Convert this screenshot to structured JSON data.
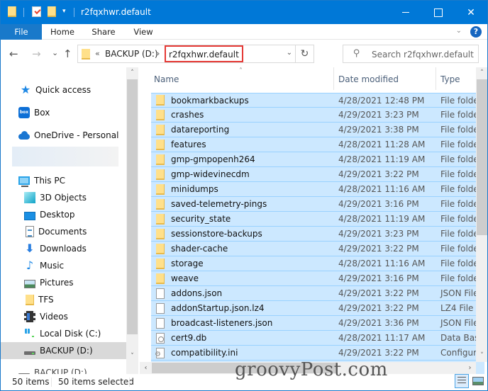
{
  "window": {
    "title": "r2fqxhwr.default",
    "minimize_icon": "minimize-icon",
    "maximize_icon": "maximize-icon",
    "close_icon": "close-icon",
    "close_glyph": "✕"
  },
  "quick_access_toolbar": {
    "items": [
      "folder-icon",
      "properties-icon",
      "new-folder-icon",
      "customize-dropdown-icon"
    ],
    "dropdown_glyph": "▾"
  },
  "ribbon": {
    "tabs": [
      {
        "label": "File"
      },
      {
        "label": "Home"
      },
      {
        "label": "Share"
      },
      {
        "label": "View"
      }
    ],
    "expand_glyph": "⌄",
    "help_glyph": "?"
  },
  "navigation": {
    "back_glyph": "←",
    "forward_glyph": "→",
    "recent_glyph": "⌄",
    "up_glyph": "↑",
    "address": {
      "overflow_glyph": "«",
      "crumbs": [
        "BACKUP (D:)"
      ],
      "separator_glyph": "›",
      "current": "r2fqxhwr.default",
      "dropdown_glyph": "⌄",
      "refresh_glyph": "↻"
    },
    "search": {
      "placeholder": "Search r2fqxhwr.default",
      "icon_glyph": "⚲"
    }
  },
  "nav_pane": {
    "items": [
      {
        "label": "Quick access",
        "icon": "quick-access-star-icon",
        "glyph": "★"
      },
      {
        "label": "Box",
        "icon": "box-icon",
        "glyph": "box"
      },
      {
        "label": "OneDrive - Personal",
        "icon": "onedrive-cloud-icon"
      },
      {
        "label": "This PC",
        "icon": "this-pc-icon"
      },
      {
        "label": "3D Objects",
        "icon": "3d-objects-icon"
      },
      {
        "label": "Desktop",
        "icon": "desktop-icon"
      },
      {
        "label": "Documents",
        "icon": "documents-icon"
      },
      {
        "label": "Downloads",
        "icon": "downloads-icon",
        "glyph": "⬇"
      },
      {
        "label": "Music",
        "icon": "music-icon",
        "glyph": "♪"
      },
      {
        "label": "Pictures",
        "icon": "pictures-icon"
      },
      {
        "label": "TFS",
        "icon": "folder-icon"
      },
      {
        "label": "Videos",
        "icon": "videos-icon"
      },
      {
        "label": "Local Disk (C:)",
        "icon": "local-disk-icon"
      },
      {
        "label": "BACKUP (D:)",
        "icon": "drive-icon",
        "selected": true
      },
      {
        "label": "BACKUP (D:)",
        "icon": "drive-icon"
      }
    ],
    "scroll_up_glyph": "˄",
    "scroll_down_glyph": "˅"
  },
  "file_list": {
    "columns": [
      {
        "label": "Name",
        "sorted": "ascending"
      },
      {
        "label": "Date modified"
      },
      {
        "label": "Type"
      }
    ],
    "sort_glyph": "˄",
    "rows": [
      {
        "name": "bookmarkbackups",
        "date": "4/28/2021 12:48 PM",
        "type": "File folder",
        "kind": "folder"
      },
      {
        "name": "crashes",
        "date": "4/29/2021 3:23 PM",
        "type": "File folder",
        "kind": "folder"
      },
      {
        "name": "datareporting",
        "date": "4/29/2021 3:38 PM",
        "type": "File folder",
        "kind": "folder"
      },
      {
        "name": "features",
        "date": "4/28/2021 11:28 AM",
        "type": "File folder",
        "kind": "folder"
      },
      {
        "name": "gmp-gmpopenh264",
        "date": "4/28/2021 11:19 AM",
        "type": "File folder",
        "kind": "folder"
      },
      {
        "name": "gmp-widevinecdm",
        "date": "4/29/2021 3:22 PM",
        "type": "File folder",
        "kind": "folder"
      },
      {
        "name": "minidumps",
        "date": "4/28/2021 11:16 AM",
        "type": "File folder",
        "kind": "folder"
      },
      {
        "name": "saved-telemetry-pings",
        "date": "4/29/2021 3:16 PM",
        "type": "File folder",
        "kind": "folder"
      },
      {
        "name": "security_state",
        "date": "4/28/2021 11:19 AM",
        "type": "File folder",
        "kind": "folder"
      },
      {
        "name": "sessionstore-backups",
        "date": "4/29/2021 3:23 PM",
        "type": "File folder",
        "kind": "folder"
      },
      {
        "name": "shader-cache",
        "date": "4/29/2021 3:22 PM",
        "type": "File folder",
        "kind": "folder"
      },
      {
        "name": "storage",
        "date": "4/28/2021 11:16 AM",
        "type": "File folder",
        "kind": "folder"
      },
      {
        "name": "weave",
        "date": "4/29/2021 3:16 PM",
        "type": "File folder",
        "kind": "folder"
      },
      {
        "name": "addons.json",
        "date": "4/29/2021 3:22 PM",
        "type": "JSON File",
        "kind": "file"
      },
      {
        "name": "addonStartup.json.lz4",
        "date": "4/29/2021 3:22 PM",
        "type": "LZ4 File",
        "kind": "file"
      },
      {
        "name": "broadcast-listeners.json",
        "date": "4/29/2021 3:36 PM",
        "type": "JSON File",
        "kind": "file"
      },
      {
        "name": "cert9.db",
        "date": "4/28/2021 11:17 AM",
        "type": "Data Base File",
        "kind": "db"
      },
      {
        "name": "compatibility.ini",
        "date": "4/29/2021 3:22 PM",
        "type": "Configuration settings",
        "kind": "ini"
      },
      {
        "name": "",
        "date": "",
        "type": "",
        "kind": "file"
      }
    ],
    "scroll_up_glyph": "˄",
    "scroll_down_glyph": "˅",
    "scroll_left_glyph": "‹",
    "scroll_right_glyph": "›"
  },
  "status_bar": {
    "item_count": "50 items",
    "selected_count": "50 items selected",
    "views": [
      "details-view-icon",
      "large-icons-view-icon"
    ]
  },
  "watermark": "groovyPost.com",
  "colors": {
    "titlebar": "#0078d7",
    "selection": "#cce8ff",
    "selection_border": "#99d1ff",
    "highlight_box": "#e53935"
  }
}
